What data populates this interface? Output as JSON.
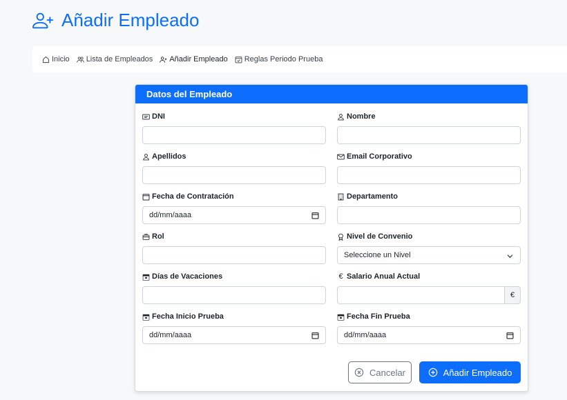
{
  "header": {
    "title": "Añadir Empleado",
    "icon": "person-plus-icon"
  },
  "breadcrumb": {
    "items": [
      {
        "label": "Inicio",
        "icon": "house-icon"
      },
      {
        "label": "Lista de Empleados",
        "icon": "people-icon"
      },
      {
        "label": "Añadir Empleado",
        "icon": "person-plus-icon"
      },
      {
        "label": "Reglas Periodo Prueba",
        "icon": "calendar-check-icon"
      }
    ]
  },
  "card": {
    "title": "Datos del Empleado"
  },
  "form": {
    "dni": {
      "label": "DNI",
      "value": ""
    },
    "nombre": {
      "label": "Nombre",
      "value": ""
    },
    "apellidos": {
      "label": "Apellidos",
      "value": ""
    },
    "email": {
      "label": "Email Corporativo",
      "value": ""
    },
    "fecha_contratacion": {
      "label": "Fecha de Contratación",
      "placeholder": "dd/mm/aaaa"
    },
    "departamento": {
      "label": "Departamento",
      "value": ""
    },
    "rol": {
      "label": "Rol",
      "value": ""
    },
    "nivel_convenio": {
      "label": "Nivel de Convenio",
      "selected": "Seleccione un Nivel"
    },
    "dias_vacaciones": {
      "label": "Días de Vacaciones",
      "value": ""
    },
    "salario": {
      "label": "Salario Anual Actual",
      "currency": "€",
      "label_icon": "€"
    },
    "fecha_inicio_prueba": {
      "label": "Fecha Inicio Prueba",
      "placeholder": "dd/mm/aaaa"
    },
    "fecha_fin_prueba": {
      "label": "Fecha Fin Prueba",
      "placeholder": "dd/mm/aaaa"
    }
  },
  "buttons": {
    "cancel": "Cancelar",
    "submit": "Añadir Empleado"
  },
  "colors": {
    "primary": "#0d6efd",
    "secondary": "#6c757d"
  }
}
